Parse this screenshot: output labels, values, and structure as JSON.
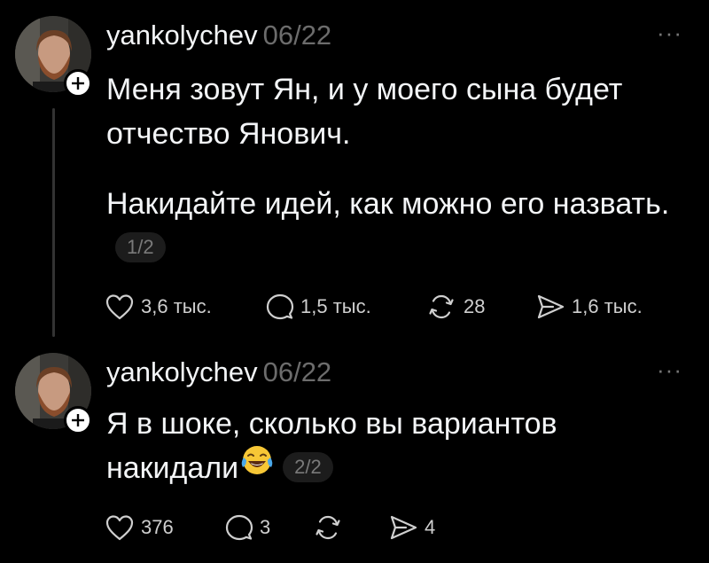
{
  "posts": [
    {
      "username": "yankolychev",
      "date": "06/22",
      "more_label": "···",
      "paragraphs": [
        "Меня зовут Ян, и у моего сына будет отчество Янович.",
        "Накидайте идей, как можно его назвать."
      ],
      "counter": "1/2",
      "likes": "3,6 тыс.",
      "replies": "1,5 тыс.",
      "reposts": "28",
      "shares": "1,6 тыс."
    },
    {
      "username": "yankolychev",
      "date": "06/22",
      "more_label": "···",
      "text": "Я в шоке, сколько вы вариантов накидали",
      "emoji": "face-with-tears-of-joy",
      "counter": "2/2",
      "likes": "376",
      "replies": "3",
      "reposts": "",
      "shares": "4"
    }
  ],
  "icons": [
    "heart-icon",
    "comment-icon",
    "repost-icon",
    "share-icon",
    "plus-icon",
    "more-icon"
  ]
}
